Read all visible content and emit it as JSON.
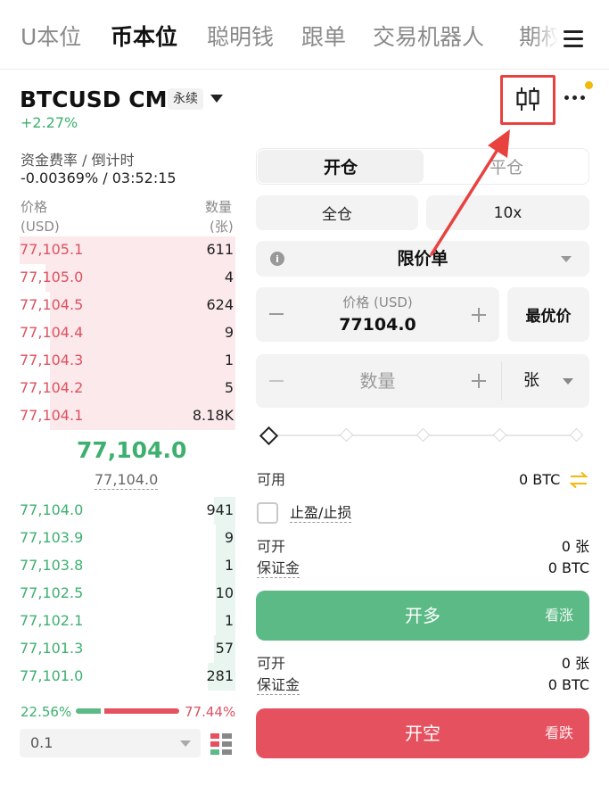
{
  "tabs": [
    "U本位",
    "币本位",
    "聪明钱",
    "跟单",
    "交易机器人",
    "期权"
  ],
  "header": {
    "symbol": "BTCUSD CM",
    "tag": "永续",
    "change": "+2.27%"
  },
  "funding": {
    "label": "资金费率 / 倒计时",
    "value": "-0.00369% / 03:52:15"
  },
  "orderbook": {
    "price_header": "价格",
    "price_unit": "(USD)",
    "qty_header": "数量",
    "qty_unit": "(张)",
    "asks": [
      {
        "price": "77,105.1",
        "qty": "611",
        "depth": 1.0
      },
      {
        "price": "77,105.0",
        "qty": "4",
        "depth": 0.88
      },
      {
        "price": "77,104.5",
        "qty": "624",
        "depth": 0.86
      },
      {
        "price": "77,104.4",
        "qty": "9",
        "depth": 0.86
      },
      {
        "price": "77,104.3",
        "qty": "1",
        "depth": 0.86
      },
      {
        "price": "77,104.2",
        "qty": "5",
        "depth": 0.86
      },
      {
        "price": "77,104.1",
        "qty": "8.18K",
        "depth": 0.86
      }
    ],
    "last_price": "77,104.0",
    "mark_price": "77,104.0",
    "bids": [
      {
        "price": "77,104.0",
        "qty": "941",
        "depth": 0.1
      },
      {
        "price": "77,103.9",
        "qty": "9",
        "depth": 0.09
      },
      {
        "price": "77,103.8",
        "qty": "1",
        "depth": 0.09
      },
      {
        "price": "77,102.5",
        "qty": "10",
        "depth": 0.09
      },
      {
        "price": "77,102.1",
        "qty": "1",
        "depth": 0.09
      },
      {
        "price": "77,101.3",
        "qty": "57",
        "depth": 0.1
      },
      {
        "price": "77,101.0",
        "qty": "281",
        "depth": 0.13
      }
    ],
    "buy_ratio": "22.56%",
    "sell_ratio": "77.44%",
    "buy_ratio_value": 0.2256,
    "precision": "0.1"
  },
  "form": {
    "open_label": "开仓",
    "close_label": "平仓",
    "margin_mode": "全仓",
    "leverage": "10x",
    "order_type": "限价单",
    "price_label": "价格 (USD)",
    "price_value": "77104.0",
    "best_price": "最优价",
    "qty_placeholder": "数量",
    "qty_unit": "张",
    "available_label": "可用",
    "available_value": "0 BTC",
    "tpsl_label": "止盈/止损",
    "long": {
      "openable_label": "可开",
      "openable_value": "0 张",
      "margin_label": "保证金",
      "margin_value": "0 BTC",
      "button": "开多",
      "sub": "看涨"
    },
    "short": {
      "openable_label": "可开",
      "openable_value": "0 张",
      "margin_label": "保证金",
      "margin_value": "0 BTC",
      "button": "开空",
      "sub": "看跌"
    }
  },
  "colors": {
    "green": "#5cba86",
    "red": "#e5515f",
    "annotation": "#e8423f"
  }
}
